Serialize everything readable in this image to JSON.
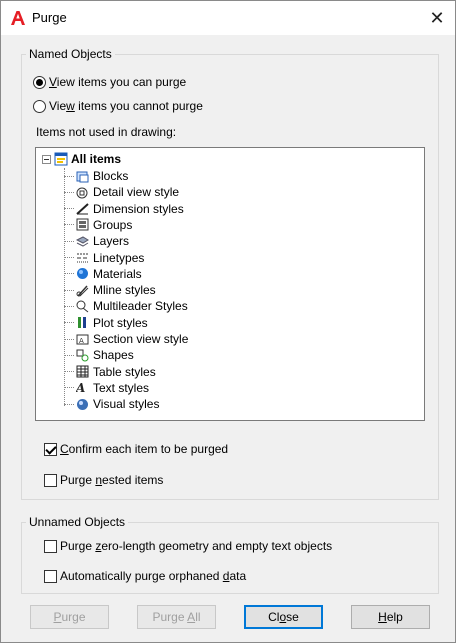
{
  "window": {
    "title": "Purge",
    "close_glyph": "✕"
  },
  "named_objects": {
    "label": "Named Objects",
    "radio_can_purge": {
      "pre": "",
      "key": "V",
      "post": "iew items you can purge",
      "selected": true
    },
    "radio_cannot_purge": {
      "pre": "Vie",
      "key": "w",
      "post": " items you cannot purge",
      "selected": false
    },
    "tree_caption": "Items not used in drawing:",
    "tree": {
      "root": "All items",
      "items": [
        {
          "label": "Blocks",
          "icon": "blocks-icon"
        },
        {
          "label": "Detail view style",
          "icon": "detail-view-icon"
        },
        {
          "label": "Dimension styles",
          "icon": "dimension-icon"
        },
        {
          "label": "Groups",
          "icon": "groups-icon"
        },
        {
          "label": "Layers",
          "icon": "layers-icon"
        },
        {
          "label": "Linetypes",
          "icon": "linetypes-icon"
        },
        {
          "label": "Materials",
          "icon": "materials-icon"
        },
        {
          "label": "Mline styles",
          "icon": "mline-icon"
        },
        {
          "label": "Multileader Styles",
          "icon": "multileader-icon"
        },
        {
          "label": "Plot styles",
          "icon": "plot-styles-icon"
        },
        {
          "label": "Section view style",
          "icon": "section-view-icon"
        },
        {
          "label": "Shapes",
          "icon": "shapes-icon"
        },
        {
          "label": "Table styles",
          "icon": "table-icon"
        },
        {
          "label": "Text styles",
          "icon": "text-styles-icon"
        },
        {
          "label": "Visual styles",
          "icon": "visual-styles-icon"
        }
      ]
    },
    "check_confirm": {
      "pre": "",
      "key": "C",
      "post": "onfirm each item to be purged",
      "checked": true
    },
    "check_nested": {
      "pre": "Purge ",
      "key": "n",
      "post": "ested items",
      "checked": false
    }
  },
  "unnamed_objects": {
    "label": "Unnamed Objects",
    "check_zero_length": {
      "pre": "Purge ",
      "key": "z",
      "post": "ero-length geometry and empty text objects",
      "checked": false
    },
    "check_orphaned": {
      "pre": "Automatically purge orphaned ",
      "key": "d",
      "post": "ata",
      "checked": false
    }
  },
  "buttons": {
    "purge": {
      "pre": "",
      "key": "P",
      "post": "urge"
    },
    "purge_all": {
      "pre": "Purge ",
      "key": "A",
      "post": "ll"
    },
    "close": {
      "pre": "Cl",
      "key": "o",
      "post": "se"
    },
    "help": {
      "pre": "",
      "key": "H",
      "post": "elp"
    }
  },
  "colors": {
    "accent": "#0078d7",
    "autocad_red": "#e51e25"
  }
}
